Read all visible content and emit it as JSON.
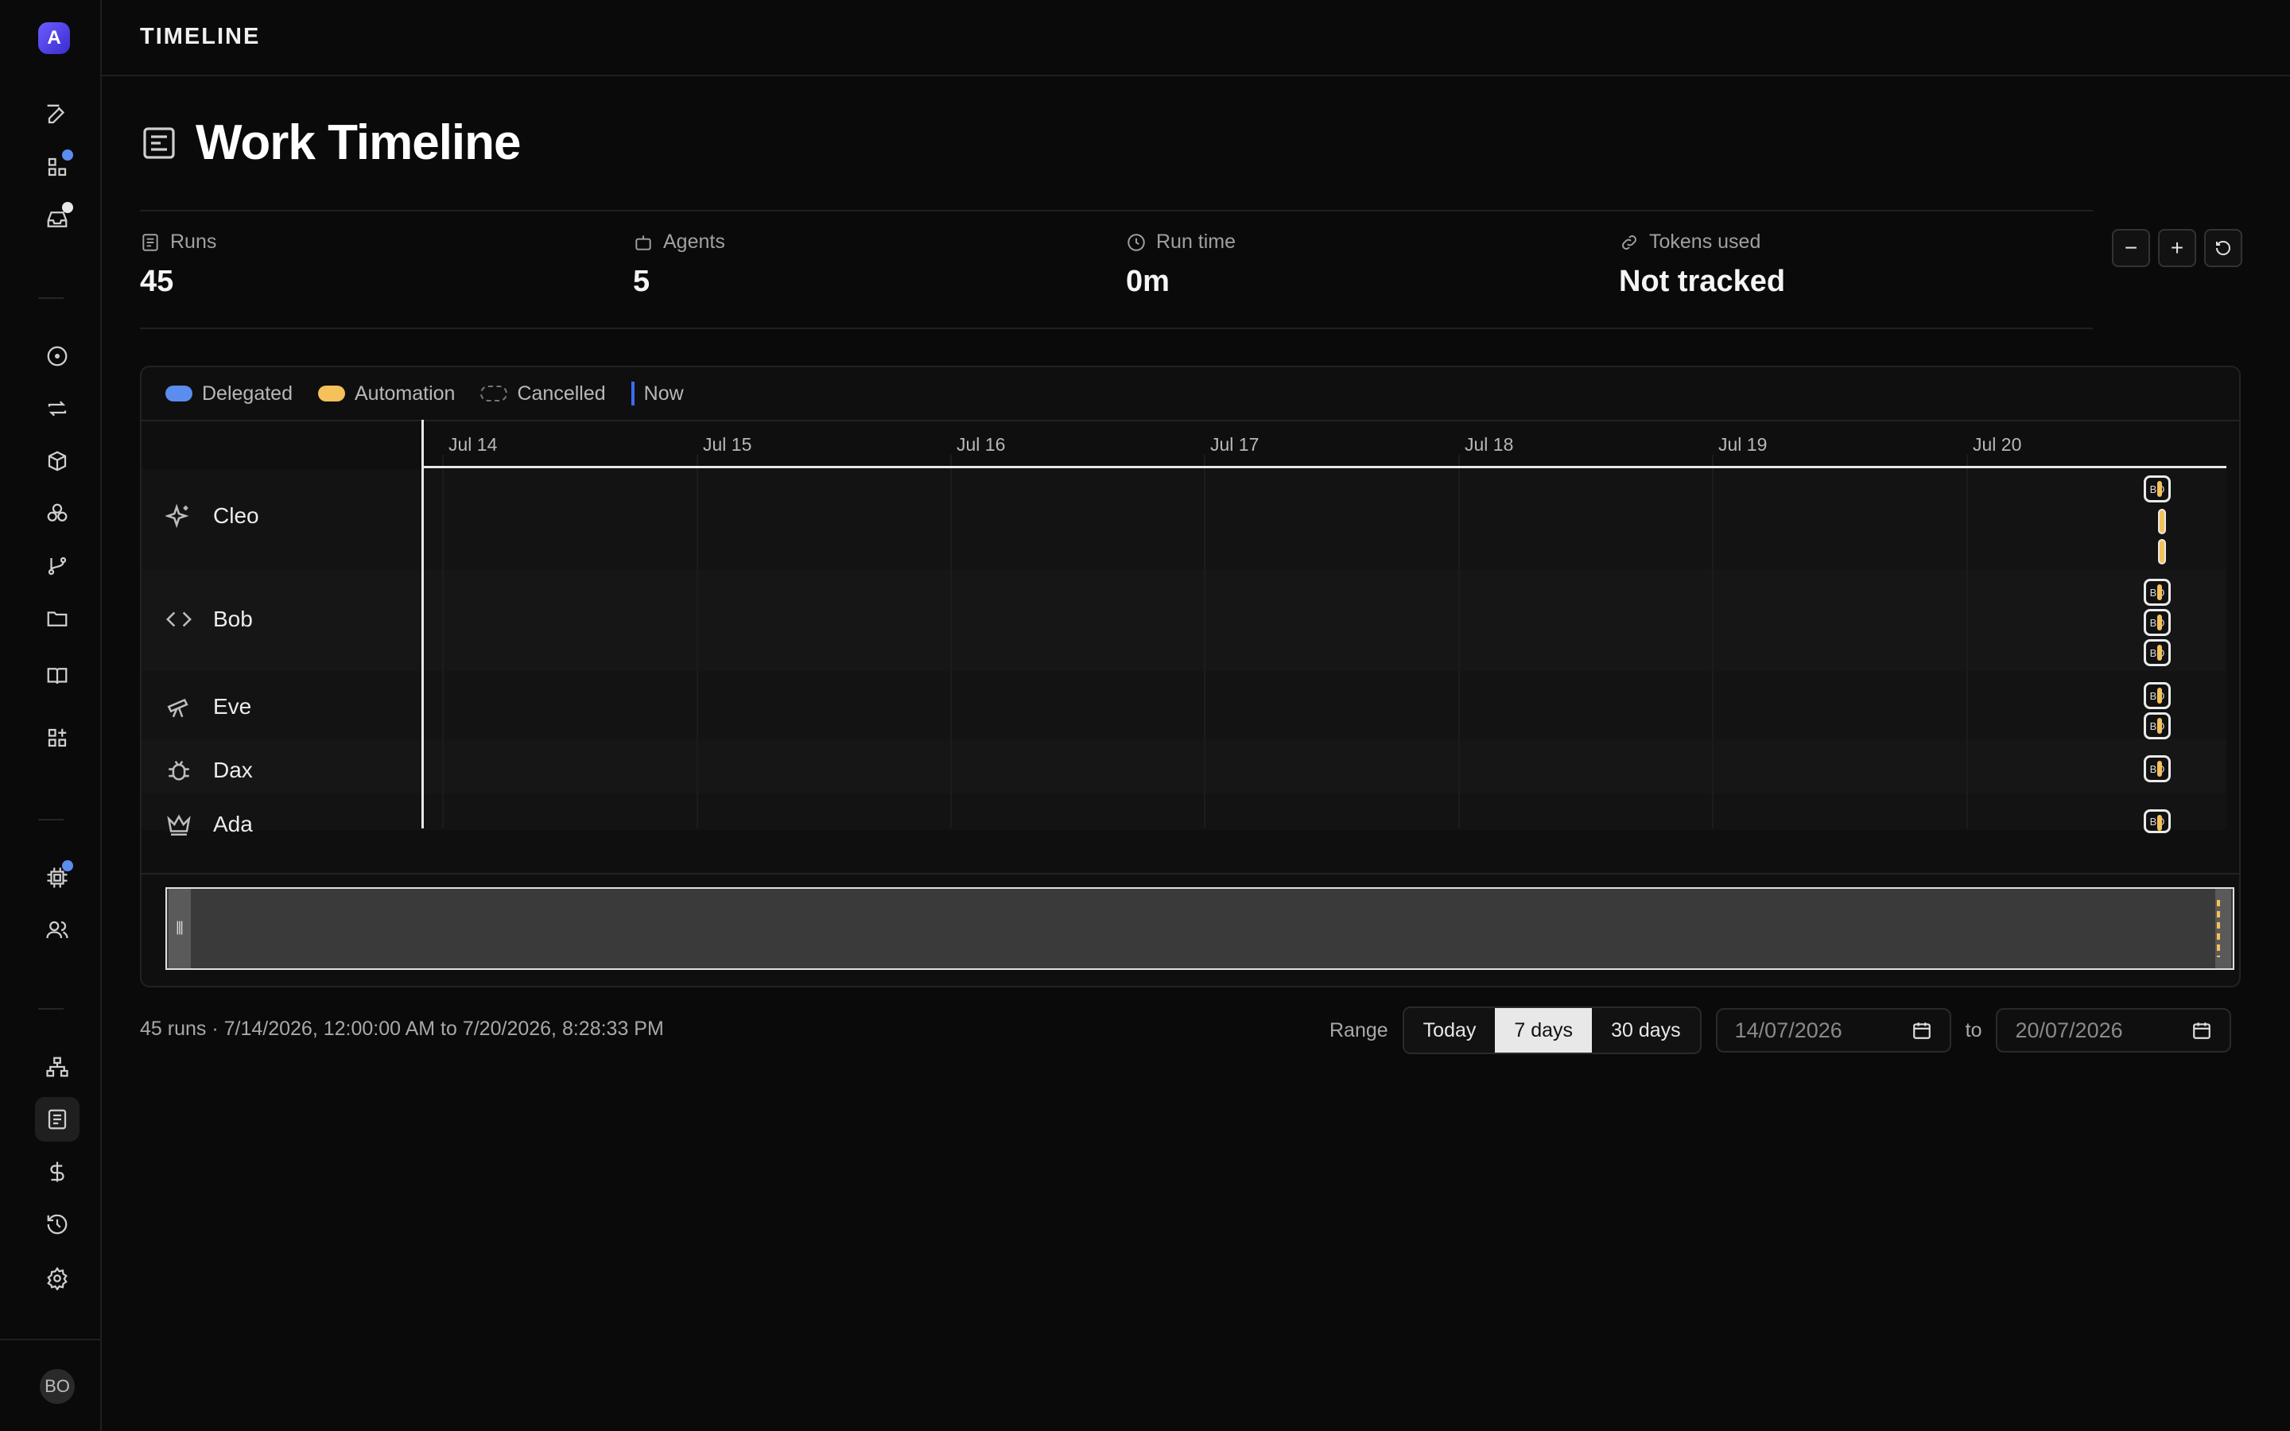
{
  "app": {
    "logo_letter": "A",
    "user_initials": "BO"
  },
  "topbar": {
    "title": "TIMELINE"
  },
  "page": {
    "title": "Work Timeline"
  },
  "stats": [
    {
      "label": "Runs",
      "value": "45",
      "icon": "list-icon"
    },
    {
      "label": "Agents",
      "value": "5",
      "icon": "robot-icon"
    },
    {
      "label": "Run time",
      "value": "0m",
      "icon": "clock-icon"
    },
    {
      "label": "Tokens used",
      "value": "Not tracked",
      "icon": "link-icon"
    }
  ],
  "zoom": {
    "out": "−",
    "in": "+"
  },
  "legend": {
    "delegated": "Delegated",
    "automation": "Automation",
    "cancelled": "Cancelled",
    "now": "Now",
    "colors": {
      "delegated": "#5b8def",
      "automation": "#f4c15a",
      "now": "#3b6cff"
    }
  },
  "axis": {
    "dates": [
      "Jul 14",
      "Jul 15",
      "Jul 16",
      "Jul 17",
      "Jul 18",
      "Jul 19",
      "Jul 20"
    ]
  },
  "agents": [
    {
      "name": "Cleo",
      "icon": "sparkle-icon",
      "runs": 3
    },
    {
      "name": "Bob",
      "icon": "code-icon",
      "runs": 3
    },
    {
      "name": "Eve",
      "icon": "telescope-icon",
      "runs": 2
    },
    {
      "name": "Dax",
      "icon": "bug-icon",
      "runs": 1
    },
    {
      "name": "Ada",
      "icon": "crown-icon",
      "runs": 1
    }
  ],
  "run_chip_text": "BO",
  "footer": {
    "summary": "45 runs · 7/14/2026, 12:00:00 AM to 7/20/2026, 8:28:33 PM",
    "range_label": "Range",
    "range_options": [
      "Today",
      "7 days",
      "30 days"
    ],
    "range_selected": "7 days",
    "from_date": "14/07/2026",
    "to_label": "to",
    "to_date": "20/07/2026"
  }
}
